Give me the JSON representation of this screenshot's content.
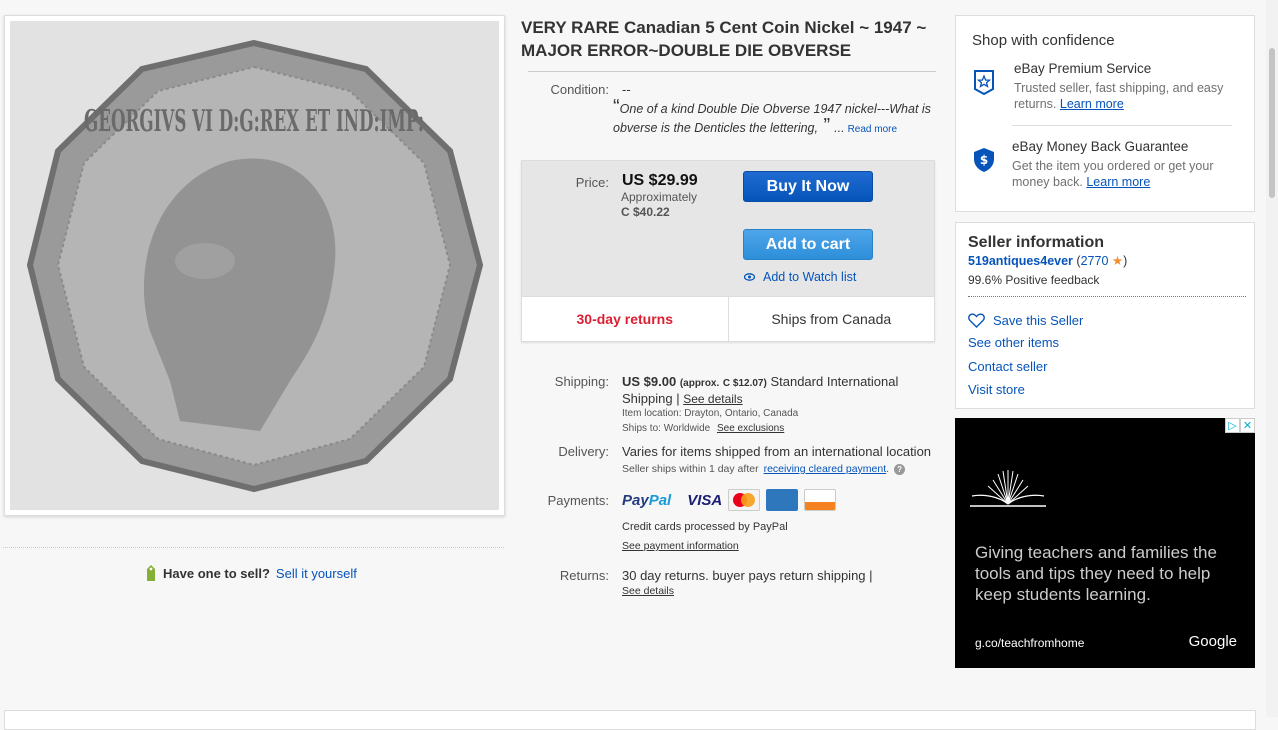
{
  "item": {
    "title": "VERY RARE Canadian 5 Cent Coin Nickel ~ 1947 ~ MAJOR ERROR~DOUBLE DIE OBVERSE",
    "coin_text": "GEORGIVS VI D:G:REX ET IND:IMP:",
    "condition_label": "Condition:",
    "condition_value": "--",
    "quote": "One of a kind Double Die Obverse 1947 nickel---What is obverse is the Denticles the lettering,",
    "quote_ellipsis": "...",
    "read_more": "Read more"
  },
  "buybox": {
    "price_label": "Price:",
    "price": "US $29.99",
    "approx": "Approximately",
    "converted": "C $40.22",
    "buy_now": "Buy It Now",
    "add_to_cart": "Add to cart",
    "watch": "Add to Watch list",
    "returns_badge": "30-day returns",
    "ships_badge": "Ships from Canada"
  },
  "shipping": {
    "label": "Shipping:",
    "amount": "US $9.00",
    "approx_prefix": "(approx.",
    "approx_value": "C $12.07)",
    "method": "Standard International Shipping |",
    "details_link": "See details",
    "location": "Item location:  Drayton, Ontario, Canada",
    "ships_to": "Ships to:  Worldwide",
    "exclusions_link": "See exclusions"
  },
  "delivery": {
    "label": "Delivery:",
    "value": "Varies for items shipped from an international location",
    "sub": "Seller ships within 1 day after",
    "sub_link": "receiving cleared payment",
    "sub_end": ".",
    "help": "?"
  },
  "payments": {
    "label": "Payments:",
    "paypal_a": "Pay",
    "paypal_b": "Pal",
    "visa": "VISA",
    "note": "Credit cards processed by PayPal",
    "info_link": "See payment information"
  },
  "returns": {
    "label": "Returns:",
    "value": "30 day returns. buyer pays return shipping |",
    "details_link": "See details"
  },
  "sell": {
    "question": "Have one to sell?",
    "link": "Sell it yourself"
  },
  "confidence": {
    "title": "Shop with confidence",
    "premium_title": "eBay Premium Service",
    "premium_desc": "Trusted seller, fast shipping, and easy returns.",
    "premium_link": "Learn more",
    "guarantee_title": "eBay Money Back Guarantee",
    "guarantee_desc": "Get the item you ordered or get your money back.",
    "guarantee_link": "Learn more"
  },
  "seller": {
    "title": "Seller information",
    "name": "519antiques4ever",
    "open": "(",
    "feedback_score": "2770",
    "star": "★",
    "close": ")",
    "positive": "99.6% Positive feedback",
    "save": "Save this Seller",
    "other_items": "See other items",
    "contact": "Contact seller",
    "visit": "Visit store"
  },
  "ad": {
    "text": "Giving teachers and families the tools and tips they need to help keep students learning.",
    "url": "g.co/teachfromhome",
    "brand": "Google",
    "badge_i": "▷",
    "badge_x": "✕"
  },
  "colors": {
    "link": "#0654ba",
    "returns_red": "#dd1e31",
    "buy_button": "#0654ba",
    "cart_button": "#2d8fd9"
  }
}
